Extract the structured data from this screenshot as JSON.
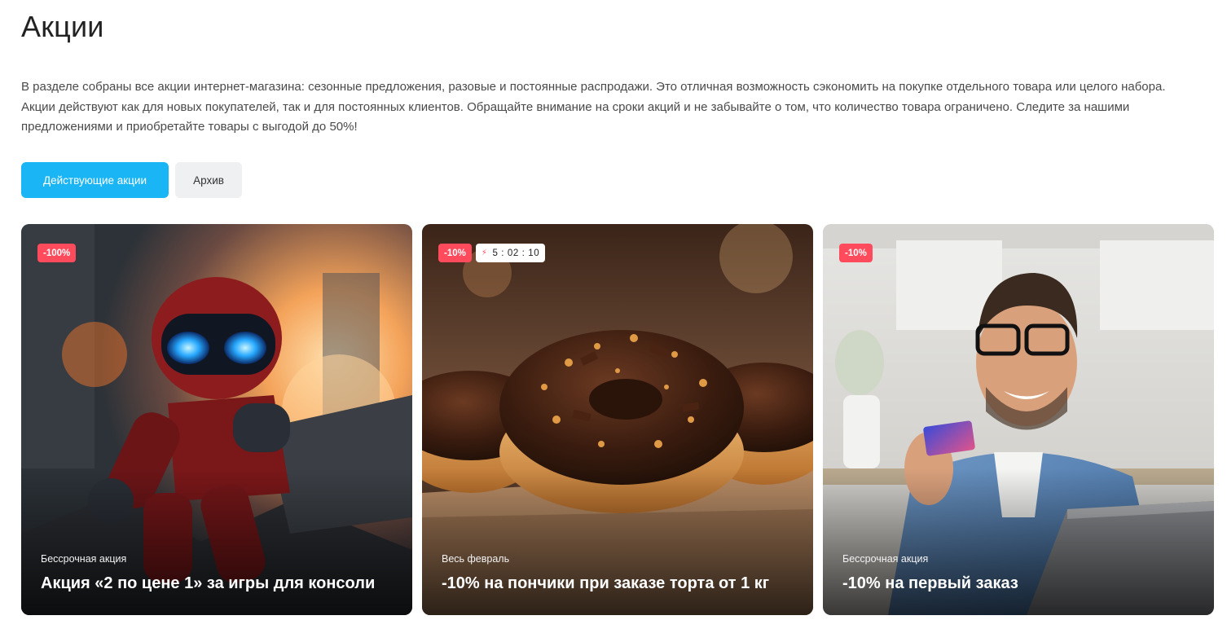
{
  "page": {
    "title": "Акции",
    "description": "В разделе собраны все акции интернет-магазина: сезонные предложения, разовые и постоянные распродажи. Это отличная возможность сэкономить на покупке отдельного товара или целого набора. Акции действуют как для новых покупателей, так и для постоянных клиентов. Обращайте внимание на сроки акций и не забывайте о том, что количество товара ограничено. Следите за нашими предложениями и приобретайте товары с выгодой до 50%!"
  },
  "tabs": [
    {
      "label": "Действующие акции",
      "active": true
    },
    {
      "label": "Архив",
      "active": false
    }
  ],
  "cards": [
    {
      "discount": "-100%",
      "timer": null,
      "period": "Бессрочная акция",
      "title": "Акция «2 по цене 1» за игры для консоли",
      "image": "robot-game-illustration"
    },
    {
      "discount": "-10%",
      "timer": "5 : 02 : 10",
      "timer_icon": "lightning-icon",
      "period": "Весь февраль",
      "title": "-10% на пончики при заказе торта от 1 кг",
      "image": "chocolate-donuts-photo"
    },
    {
      "discount": "-10%",
      "timer": null,
      "period": "Бессрочная акция",
      "title": "-10% на первый заказ",
      "image": "man-with-card-photo"
    }
  ],
  "colors": {
    "accent": "#1ab5f5",
    "badge": "#ff4b5c",
    "tab_inactive": "#eff0f2"
  }
}
